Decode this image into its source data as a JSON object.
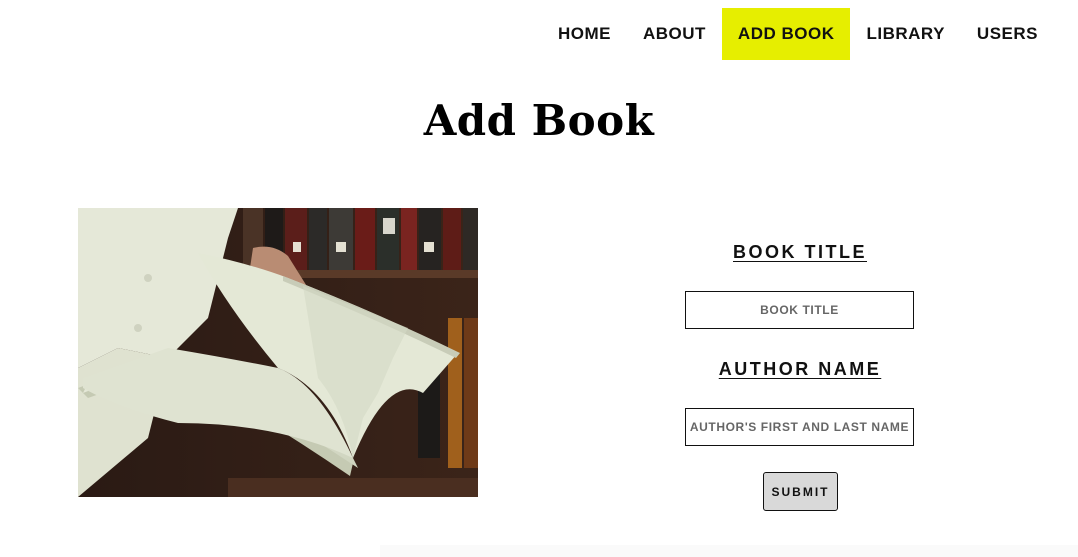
{
  "nav": {
    "items": [
      {
        "label": "HOME",
        "active": false
      },
      {
        "label": "ABOUT",
        "active": false
      },
      {
        "label": "ADD BOOK",
        "active": true
      },
      {
        "label": "LIBRARY",
        "active": false
      },
      {
        "label": "USERS",
        "active": false
      }
    ],
    "active_color": "#e6ee00"
  },
  "page": {
    "title": "Add Book"
  },
  "form": {
    "book_title_label": "BOOK TITLE",
    "book_title_placeholder": "BOOK TITLE",
    "book_title_value": "",
    "author_label": "AUTHOR NAME",
    "author_placeholder": "AUTHOR'S FIRST AND LAST NAME",
    "author_value": "",
    "submit_label": "SUBMIT"
  }
}
